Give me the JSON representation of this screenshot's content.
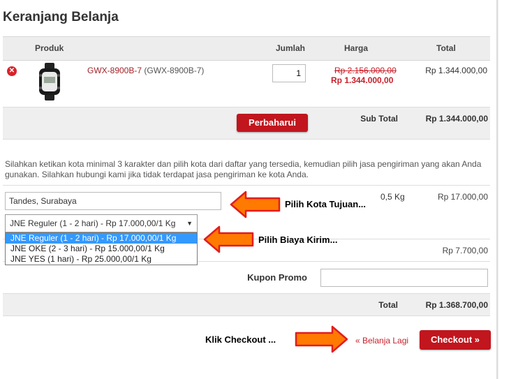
{
  "cart": {
    "title": "Keranjang Belanja",
    "columns": {
      "product": "Produk",
      "qty": "Jumlah",
      "price": "Harga",
      "total": "Total"
    },
    "item": {
      "remove_icon": "close-x-icon",
      "image_icon": "watch-image",
      "name_link": "GWX-8900B-7",
      "name_code": "(GWX-8900B-7)",
      "quantity": "1",
      "old_price": "Rp 2.156.000,00",
      "new_price": "Rp 1.344.000,00",
      "total": "Rp 1.344.000,00"
    },
    "update_button": "Perbaharui",
    "subtotal_label": "Sub Total",
    "subtotal_value": "Rp 1.344.000,00"
  },
  "shipping": {
    "info": "Silahkan ketikan kota minimal 3 karakter dan pilih kota dari daftar yang tersedia, kemudian pilih jasa pengiriman yang akan Anda gunakan. Silahkan hubungi kami jika tidak terdapat jasa pengiriman ke kota Anda.",
    "city_value": "Tandes, Surabaya",
    "weight": "0,5 Kg",
    "cost": "Rp 17.000,00",
    "service_selected": "JNE Reguler (1 - 2 hari) - Rp 17.000,00/1 Kg",
    "service_options": [
      "JNE Reguler (1 - 2 hari) - Rp 17.000,00/1 Kg",
      "JNE OKE (2 - 3 hari) - Rp 15.000,00/1 Kg",
      "JNE YES (1 hari) - Rp 25.000,00/1 Kg"
    ],
    "hidden_row_value": "Rp 7.700,00"
  },
  "promo": {
    "label": "Kupon Promo",
    "value": ""
  },
  "totals": {
    "label": "Total",
    "value": "Rp 1.368.700,00"
  },
  "actions": {
    "continue_link": "« Belanja Lagi",
    "checkout_button": "Checkout »"
  },
  "annotations": {
    "city": "Pilih Kota Tujuan...",
    "service": "Pilih Biaya Kirim...",
    "checkout": "Klik Checkout ..."
  },
  "colors": {
    "accent_red": "#c1161e",
    "arrow_orange": "#ff7a00",
    "arrow_outline": "#e11d1d"
  }
}
